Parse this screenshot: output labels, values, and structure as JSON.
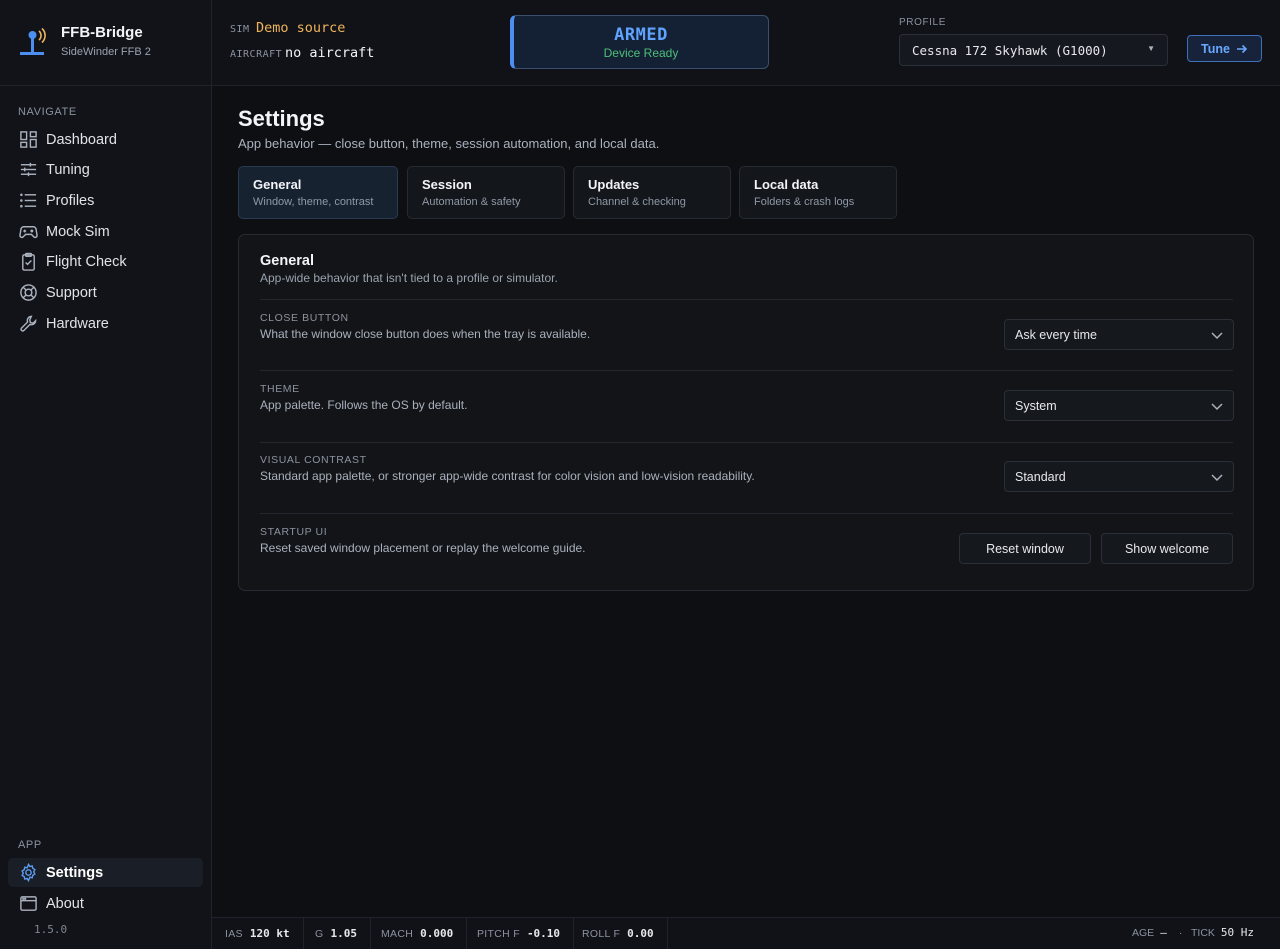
{
  "app": {
    "title": "FFB-Bridge",
    "subtitle": "SideWinder FFB 2",
    "version": "1.5.0"
  },
  "sidebar": {
    "navigate_heading": "NAVIGATE",
    "app_heading": "APP",
    "nav": [
      {
        "label": "Dashboard",
        "icon": "dashboard-icon"
      },
      {
        "label": "Tuning",
        "icon": "sliders-icon"
      },
      {
        "label": "Profiles",
        "icon": "list-icon"
      },
      {
        "label": "Mock Sim",
        "icon": "gamepad-icon"
      },
      {
        "label": "Flight Check",
        "icon": "clipboard-check-icon"
      },
      {
        "label": "Support",
        "icon": "lifebuoy-icon"
      },
      {
        "label": "Hardware",
        "icon": "wrench-icon"
      }
    ],
    "app_items": [
      {
        "label": "Settings",
        "icon": "gear-icon",
        "active": true
      },
      {
        "label": "About",
        "icon": "window-icon"
      }
    ]
  },
  "topbar": {
    "sim_key": "SIM",
    "sim_value": "Demo source",
    "aircraft_key": "AIRCRAFT",
    "aircraft_value": "no aircraft",
    "status_title": "ARMED",
    "status_sub": "Device Ready",
    "profile_label": "PROFILE",
    "profile_value": "Cessna 172 Skyhawk (G1000)",
    "tune_label": "Tune"
  },
  "page": {
    "title": "Settings",
    "subtitle": "App behavior — close button, theme, session automation, and local data."
  },
  "tabs": [
    {
      "title": "General",
      "sub": "Window, theme, contrast",
      "active": true
    },
    {
      "title": "Session",
      "sub": "Automation & safety"
    },
    {
      "title": "Updates",
      "sub": "Channel & checking"
    },
    {
      "title": "Local data",
      "sub": "Folders & crash logs"
    }
  ],
  "panel": {
    "title": "General",
    "subtitle": "App-wide behavior that isn't tied to a profile or simulator.",
    "rows": [
      {
        "key": "CLOSE BUTTON",
        "desc": "What the window close button does when the tray is available.",
        "value": "Ask every time"
      },
      {
        "key": "THEME",
        "desc": "App palette. Follows the OS by default.",
        "value": "System"
      },
      {
        "key": "VISUAL CONTRAST",
        "desc": "Standard app palette, or stronger app-wide contrast for color vision and low-vision readability.",
        "value": "Standard"
      },
      {
        "key": "STARTUP UI",
        "desc": "Reset saved window placement or replay the welcome guide.",
        "buttons": [
          "Reset window",
          "Show welcome"
        ]
      }
    ]
  },
  "statusbar": {
    "ias_key": "IAS",
    "ias_value": "120 kt",
    "g_key": "G",
    "g_value": "1.05",
    "mach_key": "MACH",
    "mach_value": "0.000",
    "pitch_key": "PITCH F",
    "pitch_value": "-0.10",
    "roll_key": "ROLL F",
    "roll_value": "0.00",
    "age_key": "AGE",
    "age_value": "—",
    "dot": "·",
    "tick_key": "TICK",
    "tick_value": "50 Hz"
  },
  "colors": {
    "accent": "#4c8ff0",
    "sim_value": "#f0b45a",
    "armed": "#5fa2ff",
    "ready": "#4fbf7a",
    "background": "#0d0f13"
  }
}
